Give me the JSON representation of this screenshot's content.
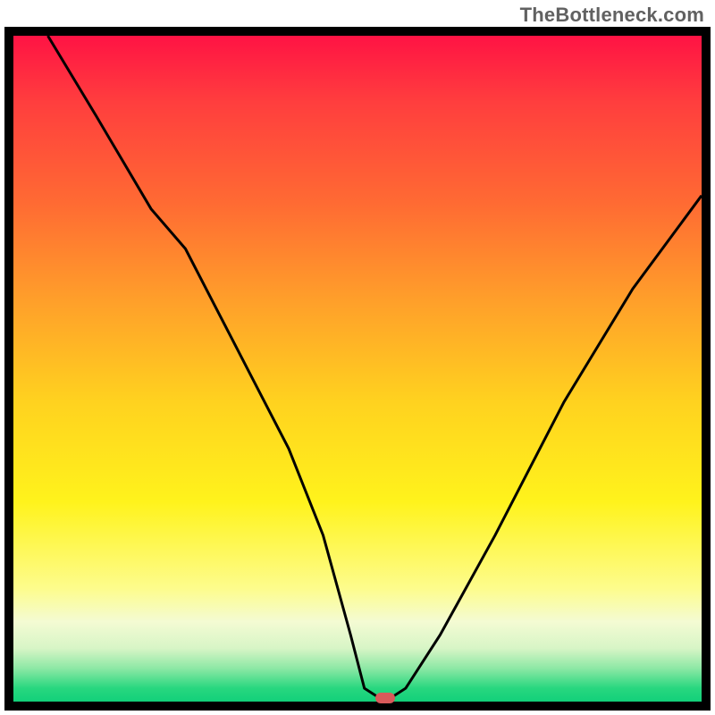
{
  "watermark": "TheBottleneck.com",
  "colors": {
    "frame_bg": "#000000",
    "marker": "#d85a5a",
    "curve": "#000000"
  },
  "chart_data": {
    "type": "line",
    "title": "",
    "xlabel": "",
    "ylabel": "",
    "xlim": [
      0,
      100
    ],
    "ylim": [
      0,
      100
    ],
    "grid": false,
    "legend": false,
    "notes": "V-shaped bottleneck curve on a vertical red→green gradient. Minimum of the curve near x≈54 at y≈0; a small rounded red marker sits at the trough. No axis ticks or numeric labels are visible.",
    "series": [
      {
        "name": "bottleneck-curve",
        "x": [
          5,
          12,
          20,
          25,
          30,
          35,
          40,
          45,
          49,
          51,
          54,
          57,
          62,
          70,
          80,
          90,
          100
        ],
        "y": [
          100,
          88,
          74,
          68,
          58,
          48,
          38,
          25,
          10,
          2,
          0,
          2,
          10,
          25,
          45,
          62,
          76
        ]
      }
    ],
    "marker": {
      "x": 54,
      "y": 0
    }
  }
}
